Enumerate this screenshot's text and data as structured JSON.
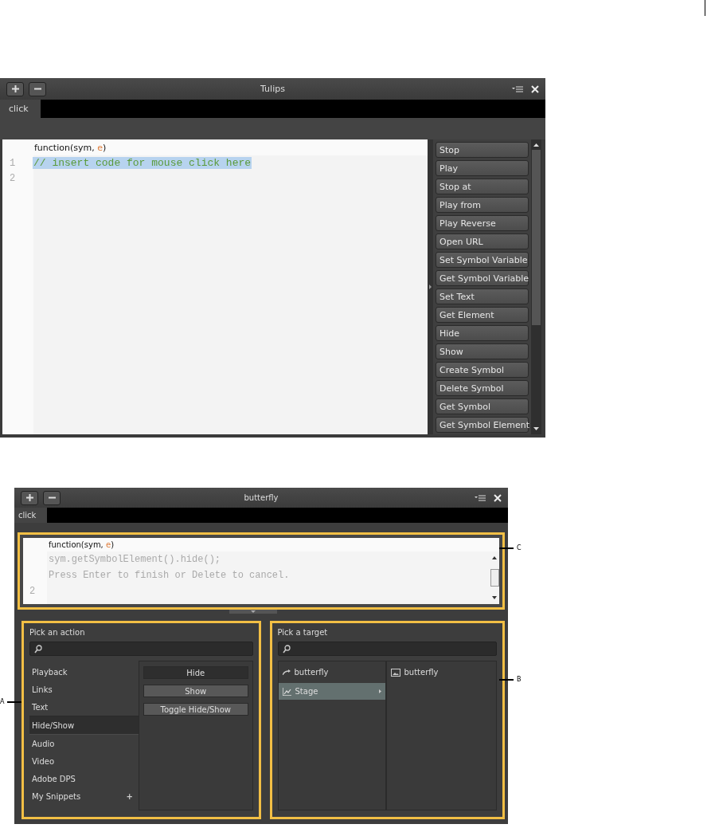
{
  "windows": [
    {
      "title": "Tulips",
      "tabs": [
        {
          "label": "click",
          "selected": true
        }
      ],
      "editor": {
        "signature": {
          "text": "function(sym, ",
          "param": "e",
          "close": ")"
        },
        "lines": [
          {
            "number": "1",
            "text": "// insert code for mouse click here",
            "selected": true
          },
          {
            "number": "2",
            "selected": false
          }
        ]
      },
      "actions": [
        "Stop",
        "Play",
        "Stop at",
        "Play from",
        "Play Reverse",
        "Open URL",
        "Set Symbol Variable",
        "Get Symbol Variable",
        "Set Text",
        "Get Element",
        "Hide",
        "Show",
        "Create Symbol",
        "Delete Symbol",
        "Get Symbol",
        "Get Symbol Element"
      ]
    },
    {
      "title": "butterfly",
      "tabs": [
        {
          "label": "click",
          "selected": true
        }
      ],
      "editor": {
        "callout": "C",
        "signature": {
          "text": "function(sym, ",
          "param": "e",
          "close": ")"
        },
        "lines": [
          {
            "kind": "hint",
            "text": "sym.getSymbolElement().hide();"
          },
          {
            "kind": "hint",
            "text": "Press Enter to finish or Delete to cancel."
          },
          {
            "kind": "code",
            "number": "2"
          }
        ]
      },
      "action_picker": {
        "callout": "A",
        "title": "Pick an action",
        "categories": [
          {
            "label": "Playback",
            "selected": false
          },
          {
            "label": "Links",
            "selected": false
          },
          {
            "label": "Text",
            "selected": false
          },
          {
            "label": "Hide/Show",
            "selected": true
          },
          {
            "label": "Audio",
            "selected": false
          },
          {
            "label": "Video",
            "selected": false
          },
          {
            "label": "Adobe DPS",
            "selected": false
          },
          {
            "label": "My Snippets",
            "selected": false,
            "add": "+"
          }
        ],
        "actions": [
          {
            "label": "Hide",
            "selected": true
          },
          {
            "label": "Show",
            "selected": false
          },
          {
            "label": "Toggle Hide/Show",
            "selected": false
          }
        ]
      },
      "target_picker": {
        "callout": "B",
        "title": "Pick a target",
        "tree": [
          {
            "label": "butterfly",
            "kind": "link",
            "selected": false,
            "expandable": false
          },
          {
            "label": "Stage",
            "kind": "stage",
            "selected": true,
            "expandable": true
          }
        ],
        "elements": [
          {
            "label": "butterfly",
            "kind": "element"
          }
        ]
      }
    }
  ]
}
